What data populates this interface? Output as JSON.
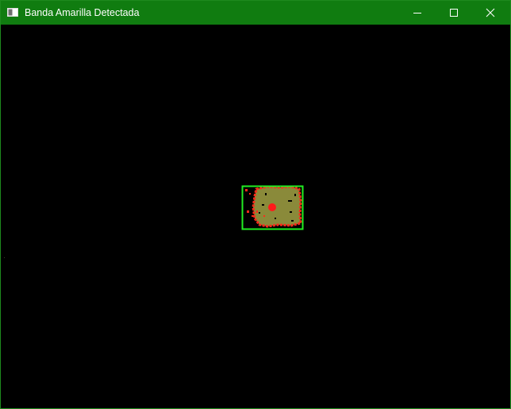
{
  "window": {
    "title": "Banda Amarilla Detectada",
    "accent_color": "#107c10",
    "buttons": [
      {
        "name": "minimize",
        "icon": "minimize-icon"
      },
      {
        "name": "maximize",
        "icon": "maximize-icon"
      },
      {
        "name": "close",
        "icon": "close-icon"
      }
    ]
  },
  "detection": {
    "object_color": "#8a8a3a",
    "box_color": "#22ee22",
    "contour_color": "#ff2a1a",
    "centroid_color": "#ff1a1a"
  }
}
